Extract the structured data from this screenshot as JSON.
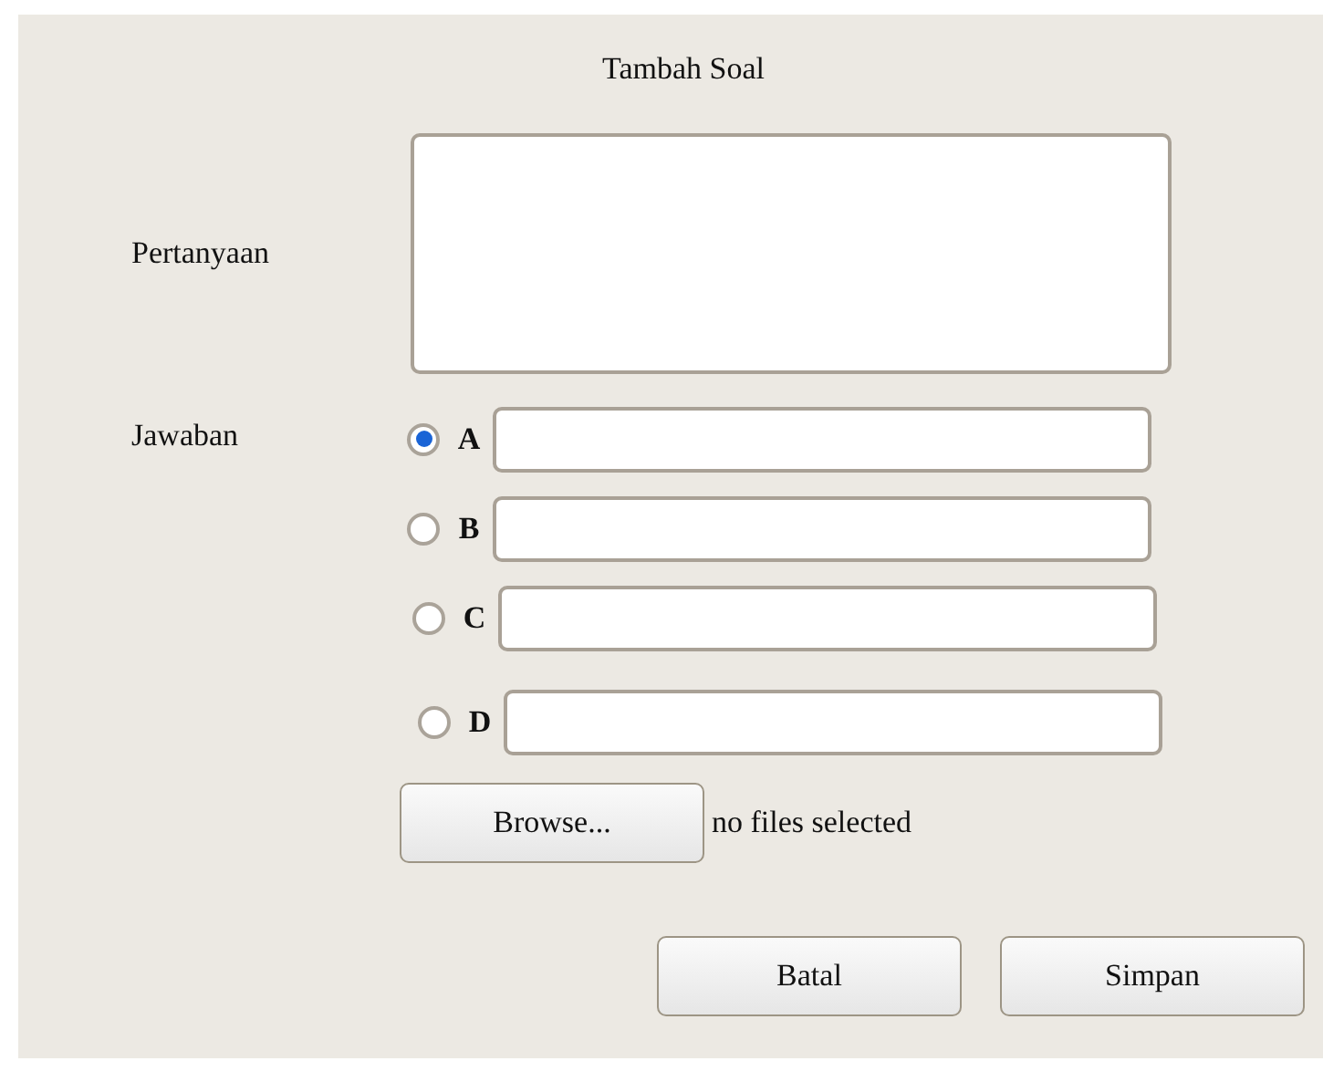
{
  "title": "Tambah Soal",
  "question": {
    "label": "Pertanyaan"
  },
  "answers": {
    "label": "Jawaban",
    "options": [
      {
        "letter": "A",
        "selected": true
      },
      {
        "letter": "B",
        "selected": false
      },
      {
        "letter": "C",
        "selected": false
      },
      {
        "letter": "D",
        "selected": false
      }
    ]
  },
  "file": {
    "button": "Browse...",
    "status": "no files selected"
  },
  "buttons": [
    "Batal",
    "Simpan"
  ]
}
